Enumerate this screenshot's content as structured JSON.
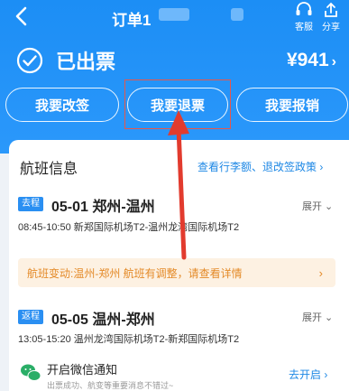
{
  "nav": {
    "title": "订单1",
    "service_label": "客服",
    "share_label": "分享"
  },
  "status": {
    "text": "已出票",
    "price": "¥941",
    "price_chevron": "›"
  },
  "actions": {
    "change": "我要改签",
    "refund": "我要退票",
    "reimburse": "我要报销"
  },
  "flight_info": {
    "title": "航班信息",
    "policy_link": "查看行李额、退改签政策",
    "policy_chevron": "›"
  },
  "segments": [
    {
      "tag": "去程",
      "date_route": "05-01 郑州-温州",
      "detail": "08:45-10:50 新郑国际机场T2-温州龙湾国际机场T2",
      "expand": "展开"
    },
    {
      "tag": "返程",
      "date_route": "05-05 温州-郑州",
      "detail": "13:05-15:20 温州龙湾国际机场T2-新郑国际机场T2",
      "expand": "展开"
    }
  ],
  "notice": {
    "text": "航班变动:温州-郑州 航班有调整，请查看详情",
    "chevron": "›"
  },
  "wechat": {
    "title": "开启微信通知",
    "subtitle": "出票成功、航变等重要消息不错过~",
    "action": "去开启"
  },
  "colors": {
    "header_blue": "#1c8ef5",
    "link_blue": "#1e88e5",
    "notice_bg": "#fdf1e2",
    "notice_text": "#e48a28",
    "highlight_red": "#e8574a",
    "wechat_green": "#2aae67"
  }
}
